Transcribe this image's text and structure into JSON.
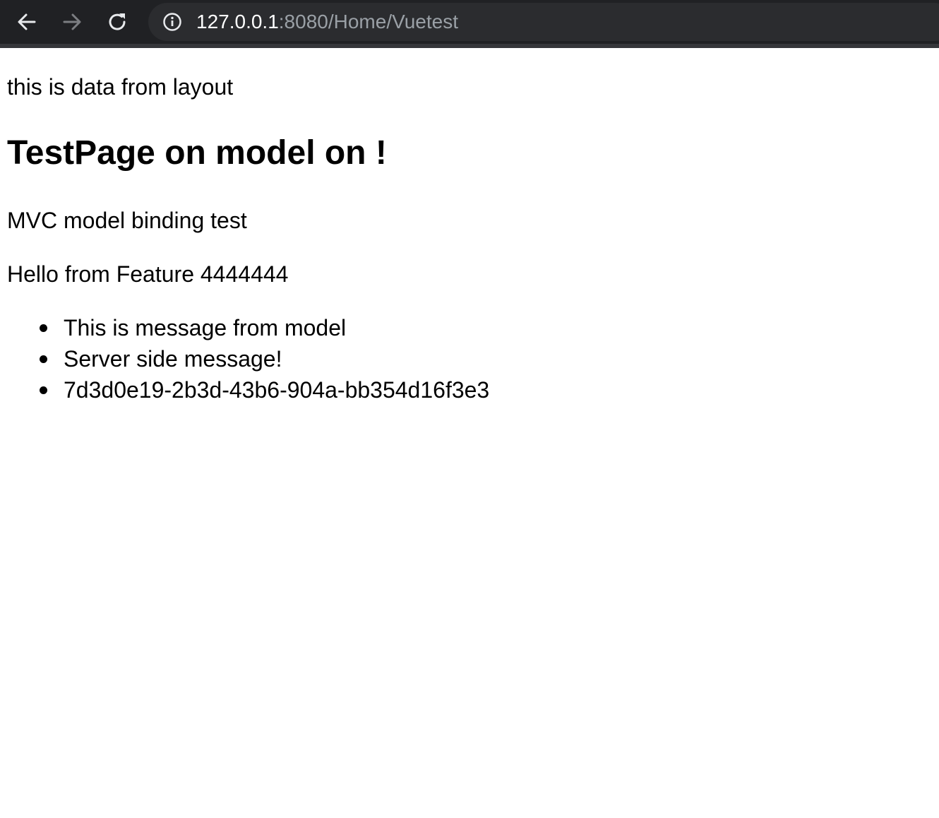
{
  "browser": {
    "url_host": "127.0.0.1",
    "url_rest": ":8080/Home/Vuetest",
    "icons": {
      "back": "arrow-left-icon",
      "forward": "arrow-right-icon",
      "reload": "reload-icon",
      "info": "info-icon"
    },
    "colors": {
      "toolbar": "#202124",
      "host_text": "#ffffff",
      "path_text": "#9aa0a6"
    }
  },
  "page": {
    "layout_text": "this is data from layout",
    "title": "TestPage on model on !",
    "subtitle": "MVC model binding test",
    "feature_text": "Hello from Feature 4444444",
    "messages": [
      "This is message from model",
      "Server side message!",
      "7d3d0e19-2b3d-43b6-904a-bb354d16f3e3"
    ]
  }
}
